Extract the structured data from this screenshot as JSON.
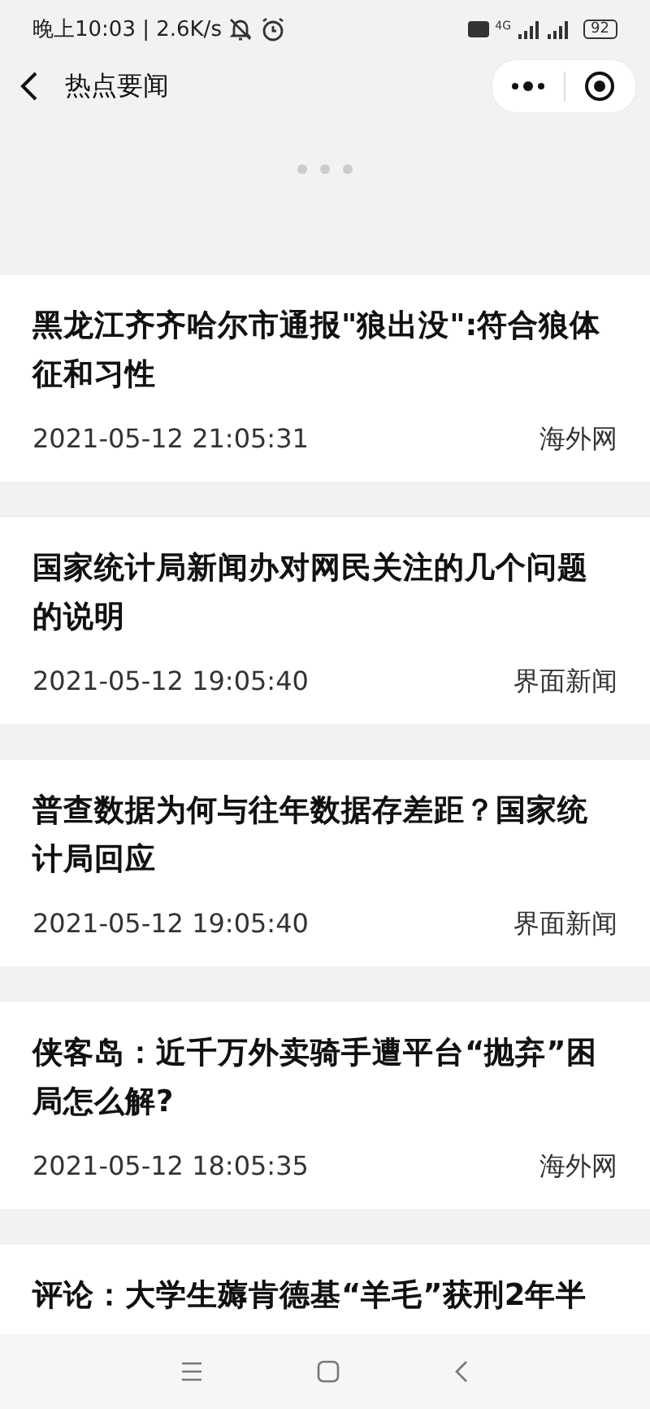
{
  "status_bar": {
    "time": "晚上10:03 | 2.6K/s",
    "network": "4G",
    "battery": "92"
  },
  "header": {
    "title": "热点要闻"
  },
  "news": [
    {
      "title": "黑龙江齐齐哈尔市通报\"狼出没\":符合狼体征和习性",
      "time": "2021-05-12 21:05:31",
      "source": "海外网"
    },
    {
      "title": "国家统计局新闻办对网民关注的几个问题的说明",
      "time": "2021-05-12 19:05:40",
      "source": "界面新闻"
    },
    {
      "title": "普查数据为何与往年数据存差距？国家统计局回应",
      "time": "2021-05-12 19:05:40",
      "source": "界面新闻"
    },
    {
      "title": "侠客岛：近千万外卖骑手遭平台“抛弃”困局怎么解?",
      "time": "2021-05-12 18:05:35",
      "source": "海外网"
    },
    {
      "title": "评论：大学生薅肯德基“羊毛”获刑2年半"
    }
  ]
}
